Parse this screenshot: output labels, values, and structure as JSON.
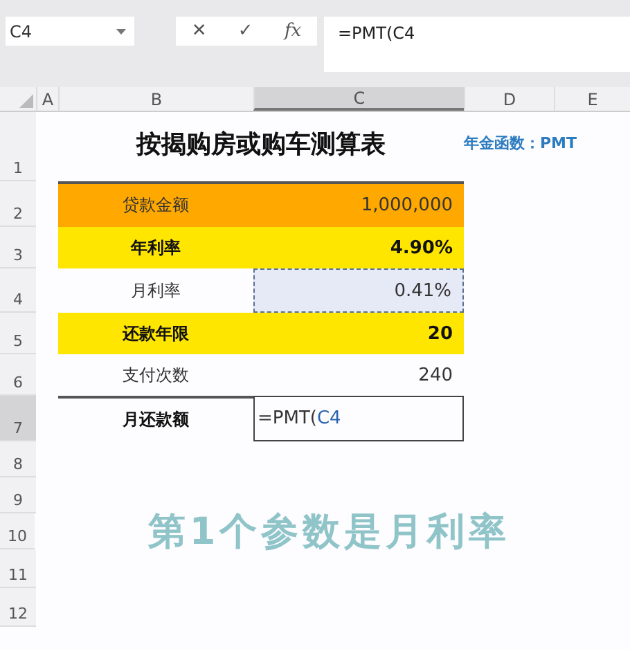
{
  "name_box": {
    "value": "C4"
  },
  "formula_bar": {
    "cancel": "✕",
    "enter": "✓",
    "function": "fx",
    "value": "=PMT(C4"
  },
  "columns": [
    {
      "label": "A",
      "selected": false
    },
    {
      "label": "B",
      "selected": false
    },
    {
      "label": "C",
      "selected": true
    },
    {
      "label": "D",
      "selected": false
    },
    {
      "label": "E",
      "selected": false
    }
  ],
  "title": "按揭购房或购车测算表",
  "side_note": "年金函数：PMT",
  "rows": [
    {
      "number": "1",
      "selected": false
    },
    {
      "number": "2",
      "selected": false,
      "color": "#ffa800",
      "bold": false,
      "label": "贷款金额",
      "value": "1,000,000"
    },
    {
      "number": "3",
      "selected": false,
      "color": "#ffe600",
      "bold": true,
      "label": "年利率",
      "value": "4.90%"
    },
    {
      "number": "4",
      "selected": false,
      "bold": false,
      "label": "月利率",
      "value": "0.41%",
      "referenced": true
    },
    {
      "number": "5",
      "selected": false,
      "color": "#ffe600",
      "bold": true,
      "label": "还款年限",
      "value": "20"
    },
    {
      "number": "6",
      "selected": false,
      "bold": false,
      "label": "支付次数",
      "value": "240"
    },
    {
      "number": "7",
      "selected": true,
      "bold": true,
      "label": "月还款额",
      "formula": "=PMT(",
      "reference": "C4"
    },
    {
      "number": "8",
      "selected": false
    },
    {
      "number": "9",
      "selected": false
    },
    {
      "number": "10",
      "selected": false
    },
    {
      "number": "11",
      "selected": false
    },
    {
      "number": "12",
      "selected": false
    }
  ],
  "caption": "第1个参数是月利率"
}
